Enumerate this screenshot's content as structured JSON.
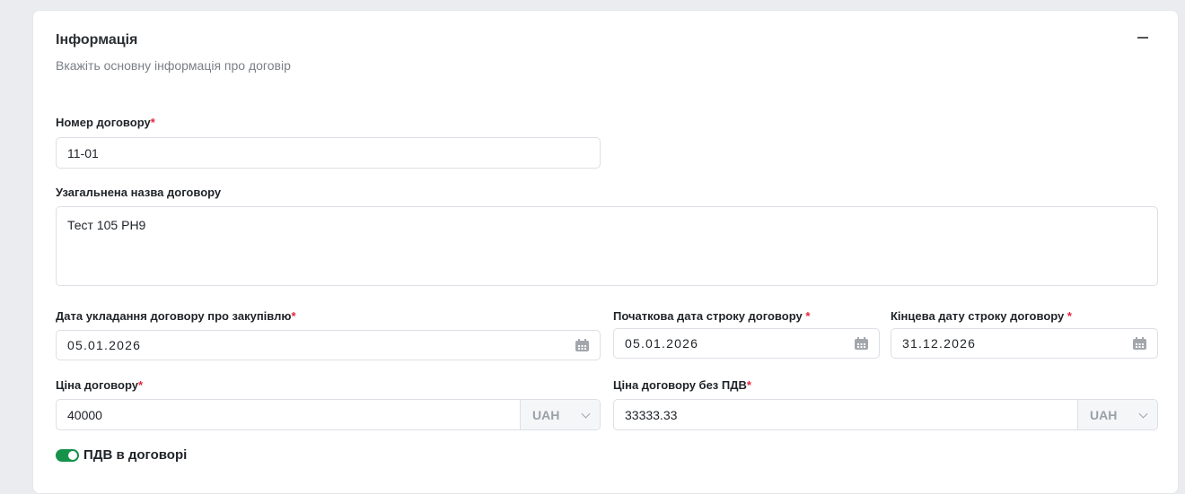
{
  "section": {
    "title": "Інформація",
    "subtitle": "Вкажіть основну інформація про договір"
  },
  "fields": {
    "number": {
      "label": "Номер договору",
      "required": "*",
      "value": "11-01"
    },
    "name": {
      "label": "Узагальнена назва договору",
      "value": "Тест 105 PH9"
    },
    "conclusion_date": {
      "label": "Дата укладання договору про закупівлю",
      "required": "*",
      "value": "05.01.2026"
    },
    "start_date": {
      "label": "Початкова дата строку договору",
      "required": "*",
      "value": "05.01.2026"
    },
    "end_date": {
      "label": "Кінцева дату строку договору",
      "required": "*",
      "value": "31.12.2026"
    },
    "price": {
      "label": "Ціна договору",
      "required": "*",
      "value": "40000",
      "currency": "UAH"
    },
    "price_no_vat": {
      "label": "Ціна договору без ПДВ",
      "required": "*",
      "value": "33333.33",
      "currency": "UAH"
    }
  },
  "vat_toggle": {
    "label": "ПДВ в договорі",
    "on": true
  },
  "colors": {
    "accent": "#16924a",
    "required": "#e5243b"
  }
}
